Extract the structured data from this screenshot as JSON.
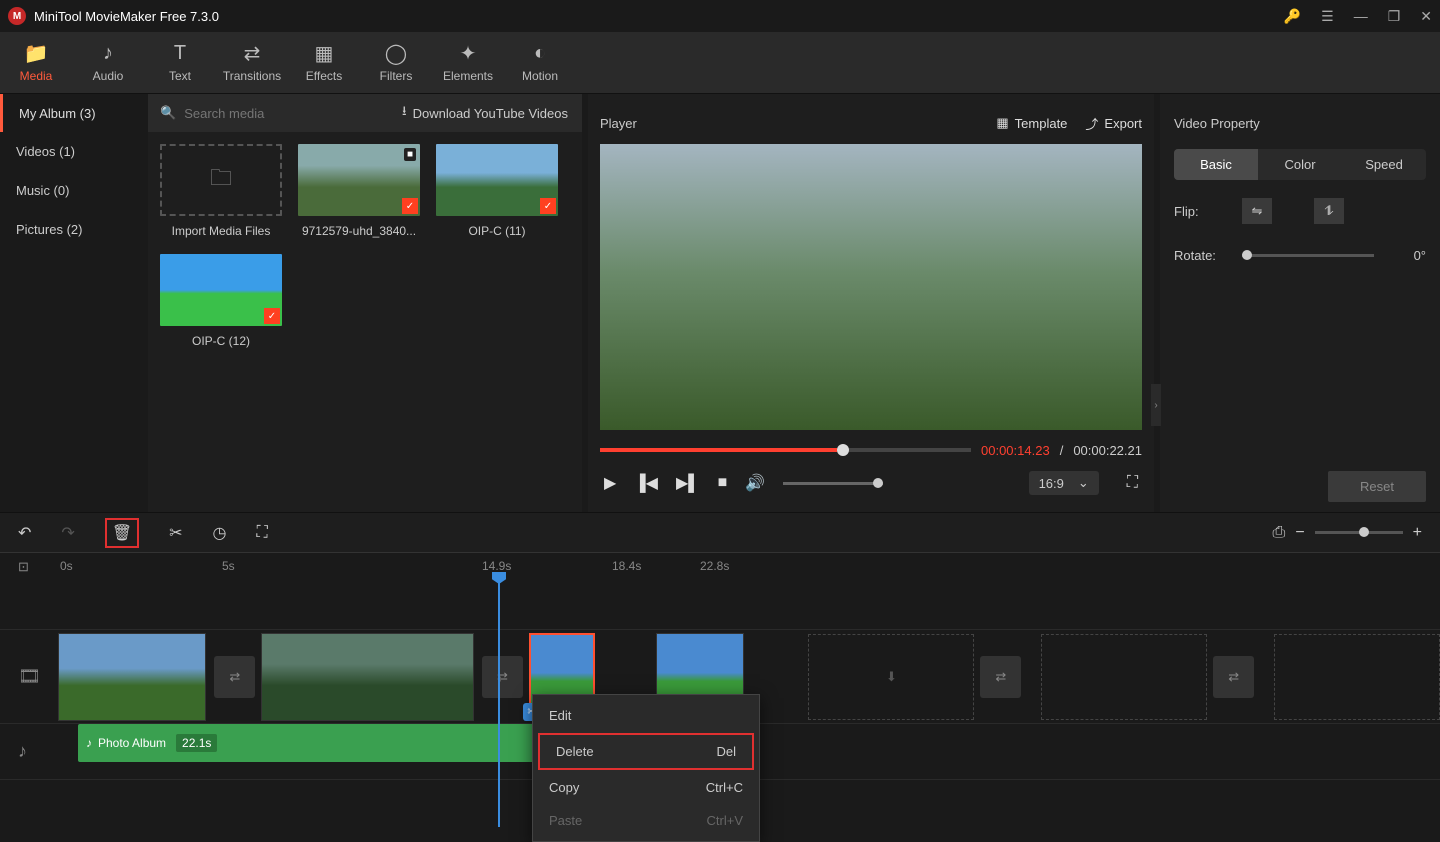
{
  "app": {
    "title": "MiniTool MovieMaker Free 7.3.0"
  },
  "toolbar": {
    "media": "Media",
    "audio": "Audio",
    "text": "Text",
    "transitions": "Transitions",
    "effects": "Effects",
    "filters": "Filters",
    "elements": "Elements",
    "motion": "Motion"
  },
  "albums": {
    "myalbum": "My Album (3)",
    "videos": "Videos (1)",
    "music": "Music (0)",
    "pictures": "Pictures (2)",
    "search_placeholder": "Search media",
    "download": "Download YouTube Videos"
  },
  "media": {
    "import": "Import Media Files",
    "items": [
      {
        "label": "9712579-uhd_3840..."
      },
      {
        "label": "OIP-C (11)"
      },
      {
        "label": "OIP-C (12)"
      }
    ]
  },
  "player": {
    "title": "Player",
    "template": "Template",
    "export": "Export",
    "time_current": "00:00:14.23",
    "time_sep": "/",
    "time_total": "00:00:22.21",
    "aspect": "16:9"
  },
  "props": {
    "title": "Video Property",
    "tabs": {
      "basic": "Basic",
      "color": "Color",
      "speed": "Speed"
    },
    "flip": "Flip:",
    "rotate": "Rotate:",
    "rotate_val": "0°",
    "reset": "Reset"
  },
  "ruler": {
    "t0": "0s",
    "t1": "5s",
    "t2": "14.9s",
    "t3": "18.4s",
    "t4": "22.8s"
  },
  "ctx": {
    "edit": "Edit",
    "delete": "Delete",
    "delete_key": "Del",
    "copy": "Copy",
    "copy_key": "Ctrl+C",
    "paste": "Paste",
    "paste_key": "Ctrl+V"
  },
  "audio": {
    "name": "Photo Album",
    "duration": "22.1s"
  }
}
